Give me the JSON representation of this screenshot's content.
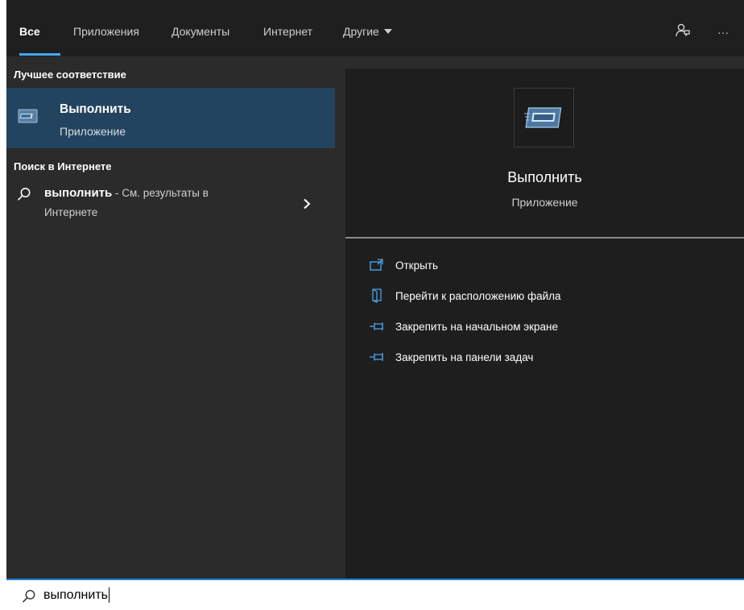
{
  "tabs": {
    "all": "Все",
    "apps": "Приложения",
    "documents": "Документы",
    "internet": "Интернет",
    "other": "Другие"
  },
  "icons": {
    "feedback": "feedback-icon",
    "more": "more-options-icon",
    "more_glyph": "···"
  },
  "left": {
    "best_match_title": "Лучшее соответствие",
    "best_match": {
      "title": "Выполнить",
      "subtitle": "Приложение"
    },
    "web_section_title": "Поиск в Интернете",
    "web_result": {
      "query": "выполнить",
      "rest": " - См. результаты в",
      "line2": "Интернете"
    }
  },
  "detail": {
    "title": "Выполнить",
    "subtitle": "Приложение",
    "actions": [
      {
        "label": "Открыть",
        "icon": "open-icon"
      },
      {
        "label": "Перейти к расположению файла",
        "icon": "file-location-icon"
      },
      {
        "label": "Закрепить на начальном экране",
        "icon": "pin-icon"
      },
      {
        "label": "Закрепить на панели задач",
        "icon": "pin-icon"
      }
    ]
  },
  "search": {
    "value": "выполнить"
  },
  "colors": {
    "accent": "#3fa9f5",
    "selected_bg": "#22445e",
    "panel_bg": "#2b2b2b",
    "detail_bg": "#1e1e1e"
  }
}
